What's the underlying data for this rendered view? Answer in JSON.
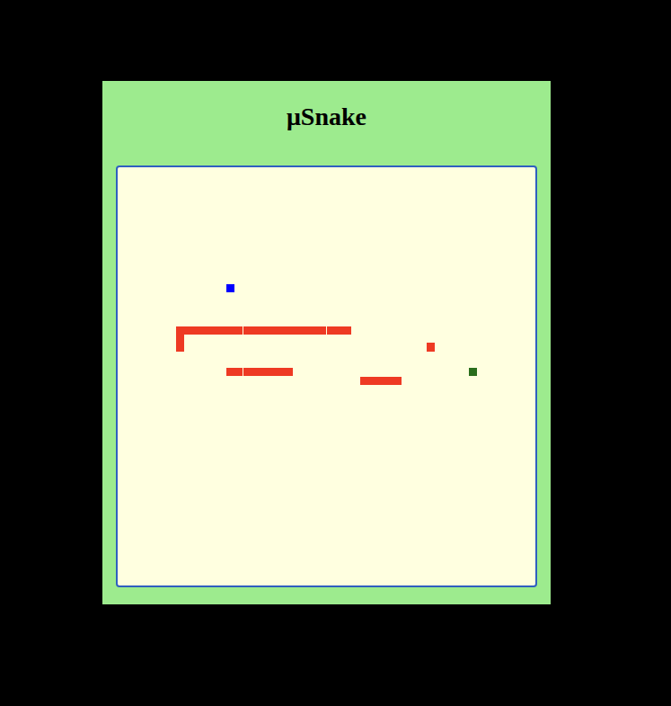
{
  "window": {
    "title": "μSnake"
  },
  "board": {
    "columns": 50,
    "rows": 50
  },
  "pieces": [
    {
      "kind": "wall",
      "color": "#ee3a23",
      "col": 7,
      "row": 19,
      "length": 21,
      "direction": "horizontal"
    },
    {
      "kind": "wall",
      "color": "#ee3a23",
      "col": 7,
      "row": 20,
      "length": 2,
      "direction": "vertical"
    },
    {
      "kind": "wall",
      "color": "#ee3a23",
      "col": 13,
      "row": 24,
      "length": 8,
      "direction": "horizontal"
    },
    {
      "kind": "wall",
      "color": "#ee3a23",
      "col": 29,
      "row": 25,
      "length": 5,
      "direction": "horizontal"
    },
    {
      "kind": "wall",
      "color": "#ee3a23",
      "col": 37,
      "row": 21,
      "length": 1,
      "direction": "horizontal"
    },
    {
      "kind": "food",
      "color": "#0000ff",
      "col": 13,
      "row": 14,
      "length": 1,
      "direction": "horizontal"
    },
    {
      "kind": "snake",
      "color": "#2a6e1c",
      "col": 42,
      "row": 24,
      "length": 1,
      "direction": "horizontal"
    }
  ]
}
